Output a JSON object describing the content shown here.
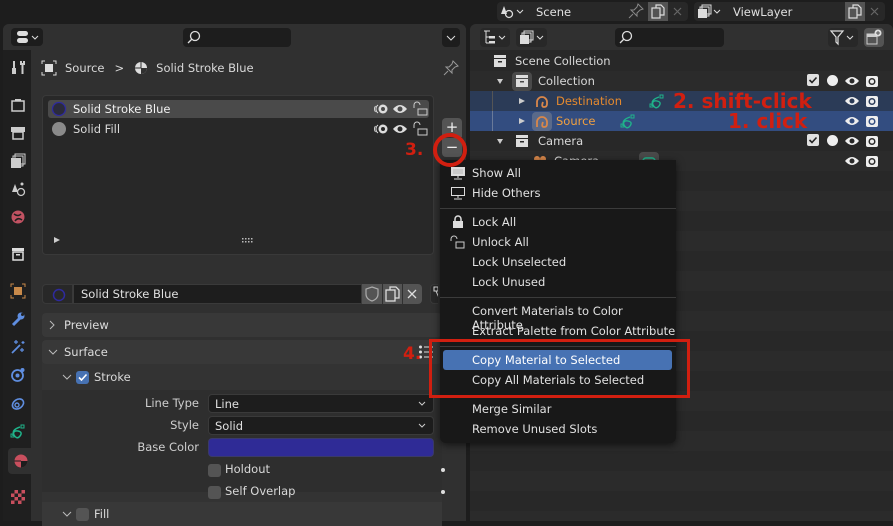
{
  "properties": {
    "header": {
      "search_placeholder": ""
    },
    "breadcrumb": {
      "object": "Source",
      "separator": ">",
      "material": "Solid Stroke Blue"
    },
    "slots": [
      {
        "name": "Solid Stroke Blue",
        "selected": true,
        "swatch": "#2e2a9e"
      },
      {
        "name": "Solid Fill",
        "selected": false,
        "swatch": "#8a8a8a"
      }
    ],
    "slot_buttons": {
      "add": "+",
      "remove": "−"
    },
    "material_field": {
      "value": "Solid Stroke Blue"
    },
    "panels": {
      "preview": "Preview",
      "surface": "Surface",
      "stroke": {
        "label": "Stroke",
        "checked": true
      },
      "line_type": {
        "label": "Line Type",
        "value": "Line"
      },
      "style": {
        "label": "Style",
        "value": "Solid"
      },
      "base_color": {
        "label": "Base Color",
        "value": "#2f2b96"
      },
      "holdout": {
        "label": "Holdout",
        "checked": false
      },
      "self_overlap": {
        "label": "Self Overlap",
        "checked": false
      },
      "fill": {
        "label": "Fill",
        "checked": false
      }
    }
  },
  "topbar": {
    "scene": "Scene",
    "view_layer": "ViewLayer"
  },
  "outliner": {
    "search_placeholder": "",
    "rows": [
      {
        "label": "Scene Collection"
      },
      {
        "label": "Collection"
      },
      {
        "label": "Destination"
      },
      {
        "label": "Source"
      },
      {
        "label": "Camera"
      },
      {
        "label": "Camera"
      }
    ]
  },
  "menu": {
    "items": [
      {
        "label": "Show All",
        "icon": "monitor-icon"
      },
      {
        "label": "Hide Others",
        "icon": "monitor-outline-icon"
      },
      {
        "label": "Lock All",
        "icon": "lock-icon"
      },
      {
        "label": "Unlock All",
        "icon": "unlock-icon"
      },
      {
        "label": "Lock Unselected"
      },
      {
        "label": "Lock Unused"
      },
      {
        "label": "Convert Materials to Color Attribute"
      },
      {
        "label": "Extract Palette from Color Attribute"
      },
      {
        "label": "Copy Material to Selected",
        "highlighted": true
      },
      {
        "label": "Copy All Materials to Selected"
      },
      {
        "label": "Merge Similar"
      },
      {
        "label": "Remove Unused Slots"
      }
    ]
  },
  "annotations": {
    "step1": "1. click",
    "step2": "2. shift-click",
    "step3": "3.",
    "step4": "4.",
    "color": "#d11f10"
  }
}
